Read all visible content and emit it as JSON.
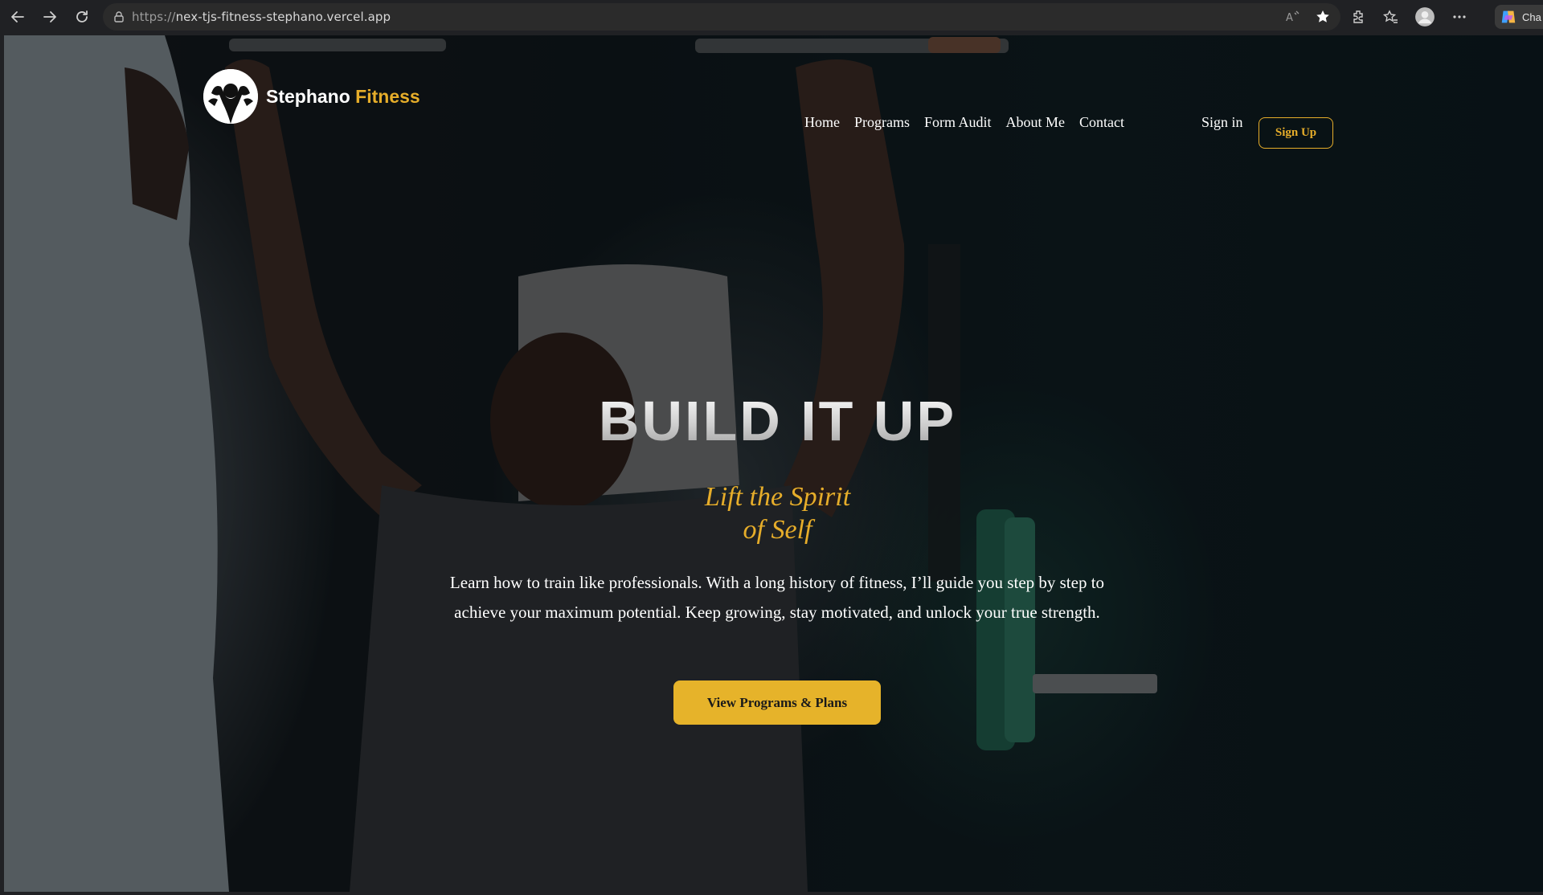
{
  "browser": {
    "url_protocol": "https://",
    "url_host": "nex-tjs-fitness-stephano.vercel.app",
    "copilot_label": "Cha"
  },
  "site": {
    "logo_name": "Stephano",
    "logo_accent": "Fitness",
    "nav": [
      "Home",
      "Programs",
      "Form Audit",
      "About Me",
      "Contact"
    ],
    "signin_label": "Sign in",
    "signup_label": "Sign Up"
  },
  "hero": {
    "title": "BUILD IT UP",
    "tagline_line1": "Lift the Spirit",
    "tagline_line2": "of Self",
    "description": "Learn how to train like professionals. With a long history of fitness, I’ll guide you step by step to achieve your maximum potential. Keep growing, stay motivated, and unlock your true strength.",
    "cta_label": "View Programs & Plans"
  },
  "colors": {
    "accent": "#e6ad2a",
    "cta_bg": "#e6b32a",
    "browser_bg": "#202124"
  }
}
